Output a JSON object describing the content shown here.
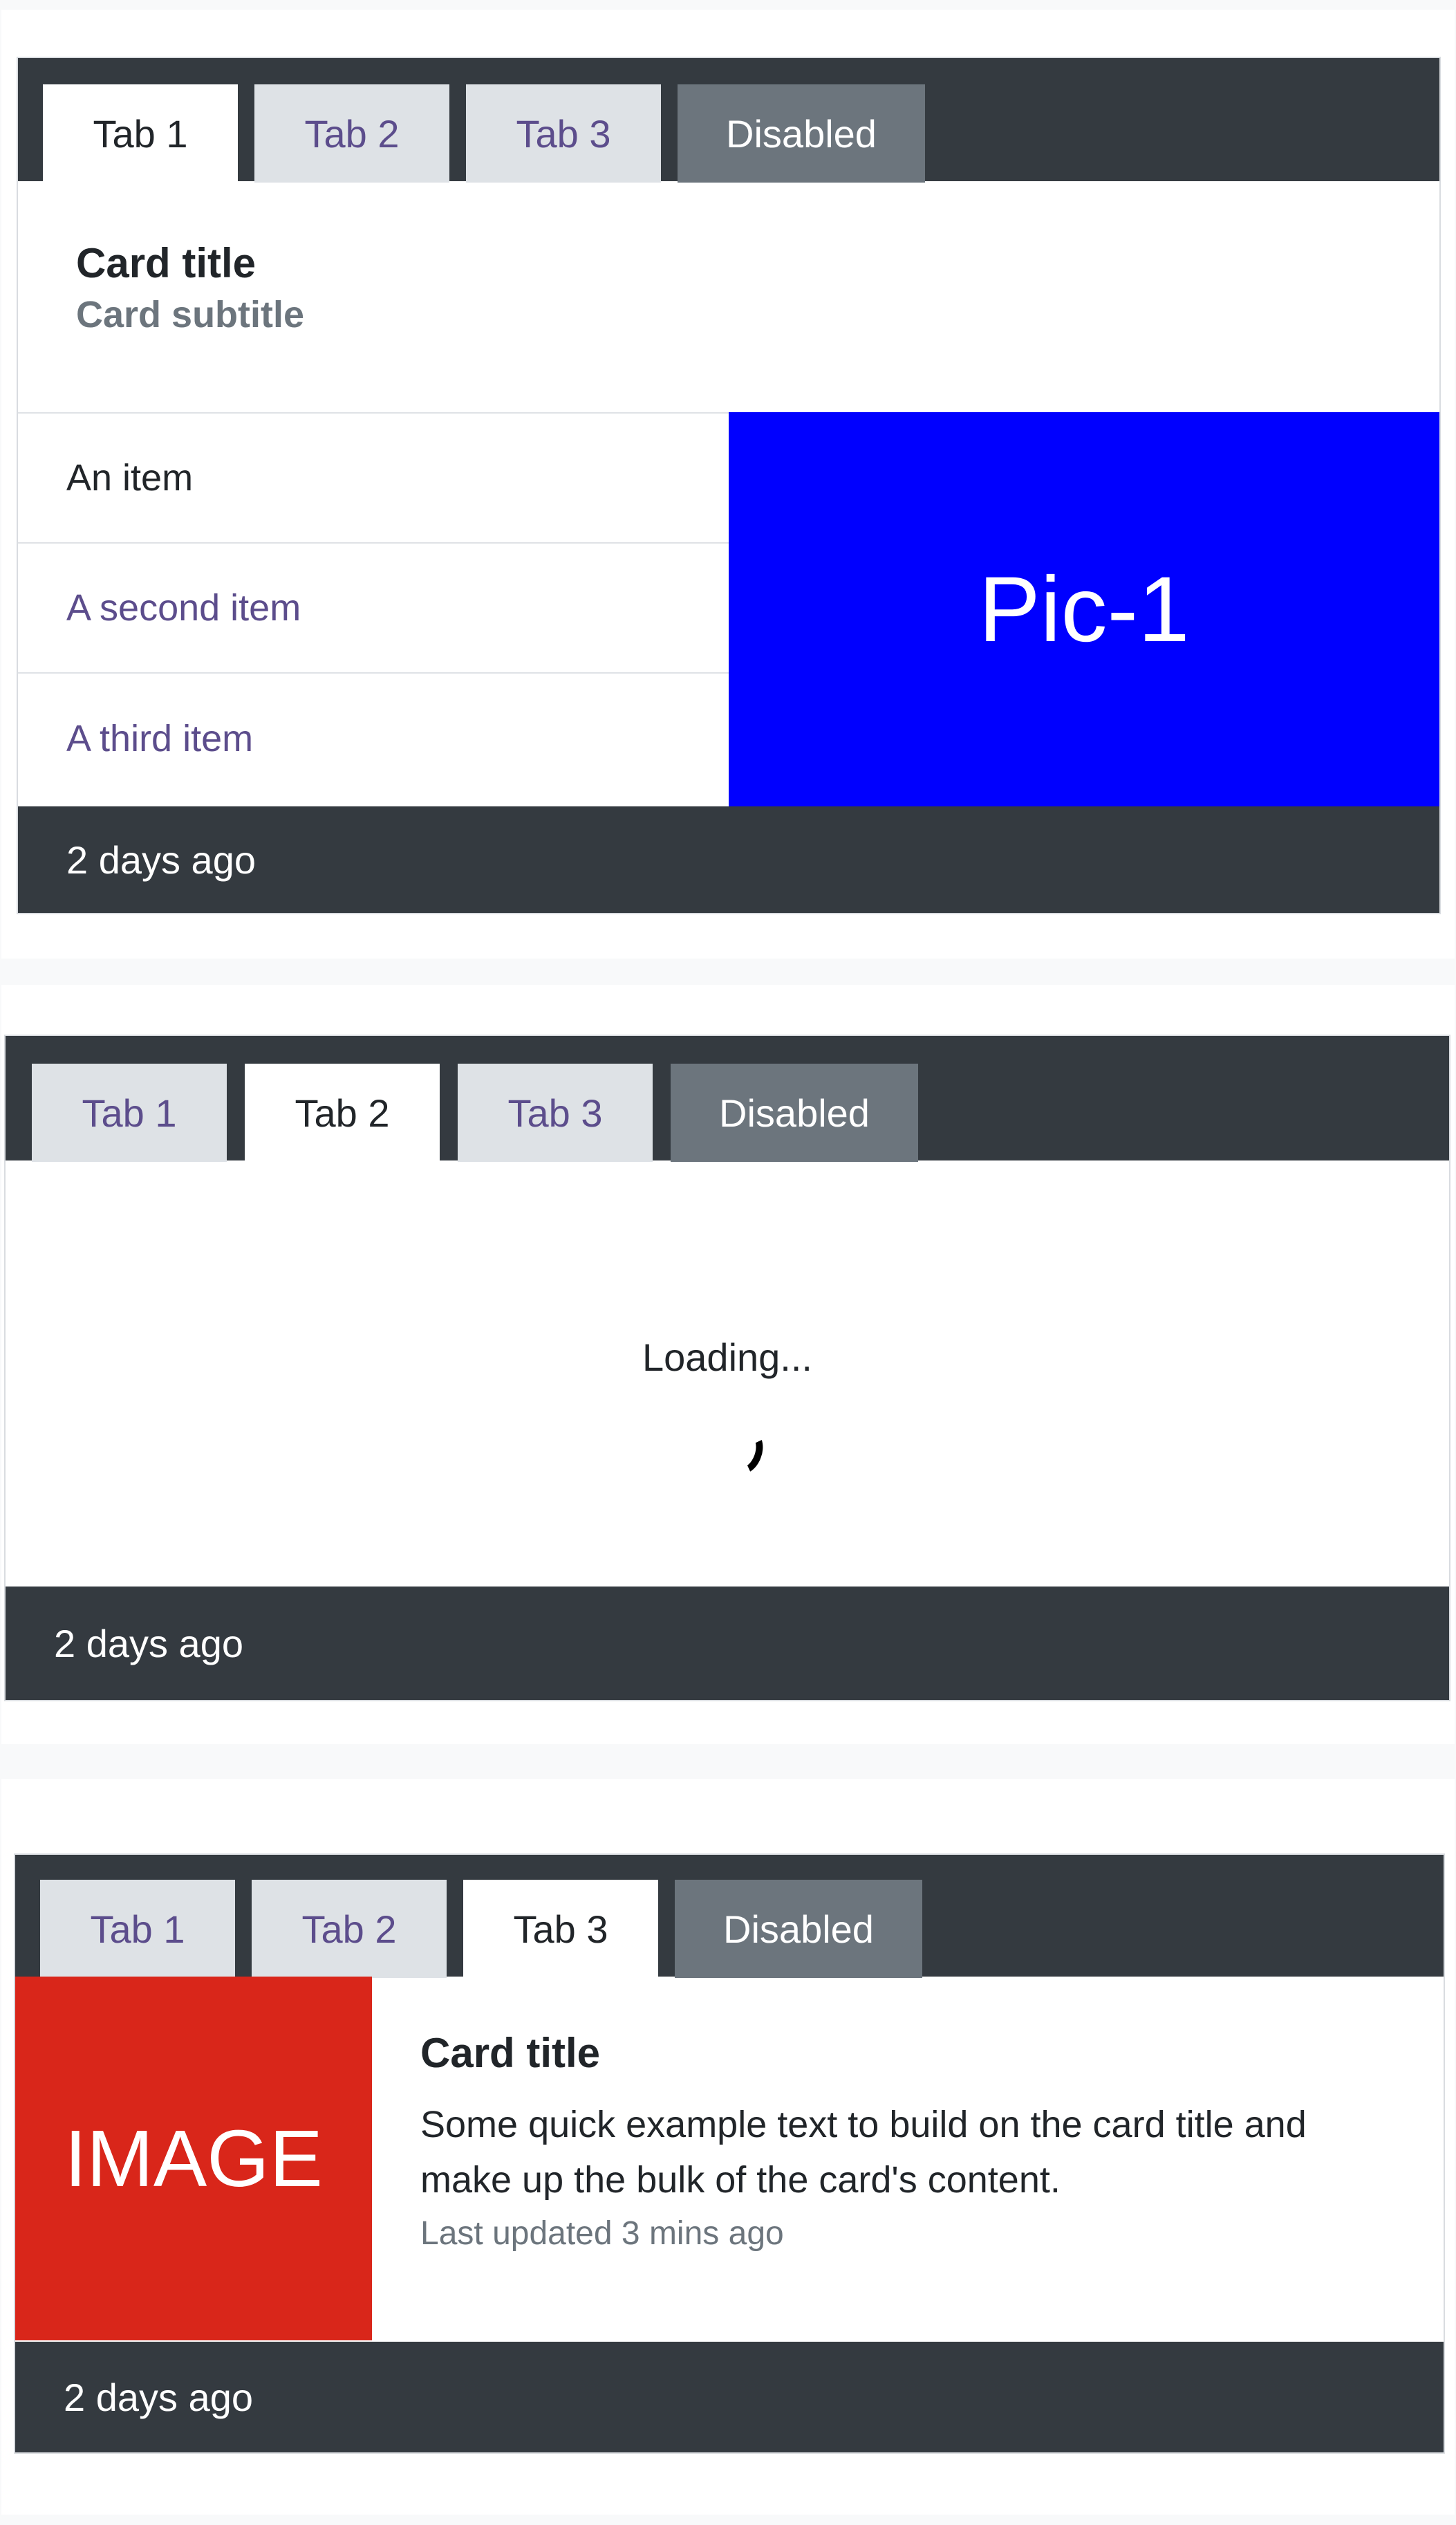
{
  "colors": {
    "tabbar": "#343a40",
    "tab_inactive_bg": "#dee2e6",
    "tab_link": "#5c4d8c",
    "tab_disabled_bg": "#6c757d",
    "pic_bg": "#0000ff",
    "image_bg": "#d9261a"
  },
  "cards": [
    {
      "tabs": [
        "Tab 1",
        "Tab 2",
        "Tab 3",
        "Disabled"
      ],
      "active_tab": "Tab 1",
      "title": "Card title",
      "subtitle": "Card subtitle",
      "list_items": [
        "An item",
        "A second item",
        "A third item"
      ],
      "picture_label": "Pic-1",
      "footer": "2 days ago"
    },
    {
      "tabs": [
        "Tab 1",
        "Tab 2",
        "Tab 3",
        "Disabled"
      ],
      "active_tab": "Tab 2",
      "loading_text": "Loading...",
      "footer": "2 days ago"
    },
    {
      "tabs": [
        "Tab 1",
        "Tab 2",
        "Tab 3",
        "Disabled"
      ],
      "active_tab": "Tab 3",
      "image_label": "IMAGE",
      "title": "Card title",
      "text": "Some quick example text to build on the card title and make up the bulk of the card's content.",
      "updated": "Last updated 3 mins ago",
      "footer": "2 days ago"
    }
  ]
}
